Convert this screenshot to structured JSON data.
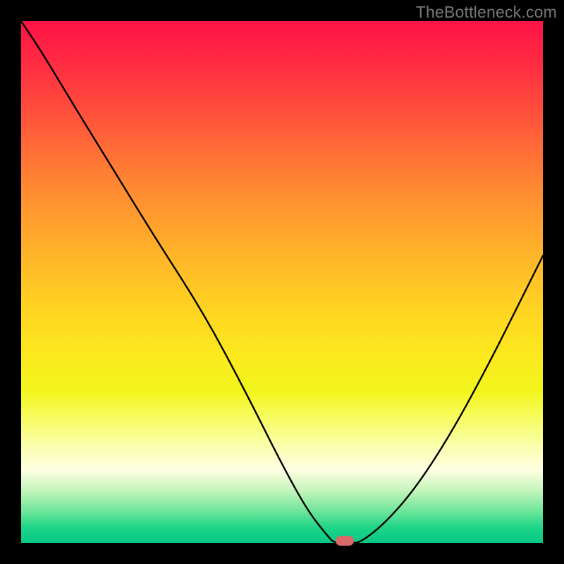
{
  "watermark": "TheBottleneck.com",
  "chart_data": {
    "type": "line",
    "title": "",
    "xlabel": "",
    "ylabel": "",
    "xlim": [
      0,
      100
    ],
    "ylim": [
      0,
      100
    ],
    "x": [
      0,
      4,
      10,
      18,
      26,
      35,
      43,
      50,
      55,
      59,
      60,
      63,
      65,
      70,
      76,
      83,
      90,
      96,
      100
    ],
    "y": [
      100,
      94,
      84,
      71,
      58,
      44,
      29,
      15,
      6,
      1,
      0,
      0,
      0,
      4,
      11,
      22,
      35,
      47,
      55
    ],
    "minimum_marker": {
      "x": 62,
      "y": 0
    },
    "gradient_stops": [
      {
        "pos": 0.0,
        "color": "#ff1347"
      },
      {
        "pos": 0.55,
        "color": "#ffd322"
      },
      {
        "pos": 0.86,
        "color": "#fefee2"
      },
      {
        "pos": 1.0,
        "color": "#06c886"
      }
    ],
    "marker_color": "#d96a6a"
  }
}
